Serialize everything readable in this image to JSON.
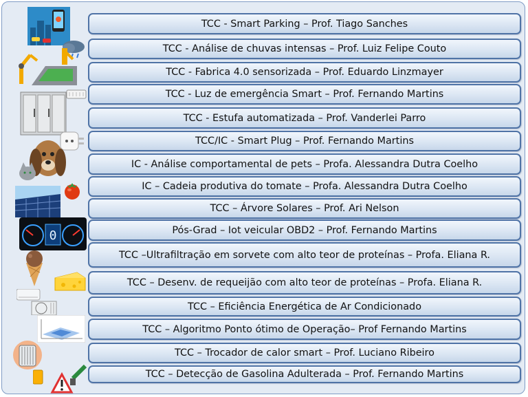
{
  "items": [
    {
      "label": "TCC - Smart Parking – Prof. Tiago Sanches"
    },
    {
      "label": "TCC - Análise de chuvas intensas – Prof. Luiz Felipe Couto"
    },
    {
      "label": "TCC - Fabrica 4.0 sensorizada – Prof. Eduardo Linzmayer"
    },
    {
      "label": "TCC - Luz de emergência Smart – Prof. Fernando Martins"
    },
    {
      "label": "TCC - Estufa automatizada – Prof. Vanderlei Parro"
    },
    {
      "label": "TCC/IC - Smart Plug – Prof. Fernando Martins"
    },
    {
      "label": "IC - Análise comportamental de pets – Profa. Alessandra Dutra Coelho"
    },
    {
      "label": "IC – Cadeia produtiva do tomate – Profa. Alessandra Dutra Coelho"
    },
    {
      "label": "TCC – Árvore Solares – Prof. Ari Nelson"
    },
    {
      "label": "Pós-Grad – Iot veicular OBD2 – Prof. Fernando Martins"
    },
    {
      "label": "TCC –Ultrafiltração em sorvete com alto teor de proteínas – Profa. Eliana R."
    },
    {
      "label": "TCC – Desenv. de requeijão com alto teor de proteínas – Profa. Eliana R."
    },
    {
      "label": "TCC – Eficiência Energética de Ar Condicionado"
    },
    {
      "label": "TCC – Algoritmo Ponto ótimo de Operação– Prof Fernando Martins"
    },
    {
      "label": "TCC – Trocador de calor smart – Prof. Luciano Ribeiro"
    },
    {
      "label": "TCC – Detecção de Gasolina Adulterada – Prof. Fernando Martins"
    }
  ],
  "dashboard": {
    "speed_digit": "0"
  },
  "colors": {
    "panel": "#e4ebf4",
    "bar_border": "#4f73a6",
    "bar_fill": "#dbe6f3"
  }
}
